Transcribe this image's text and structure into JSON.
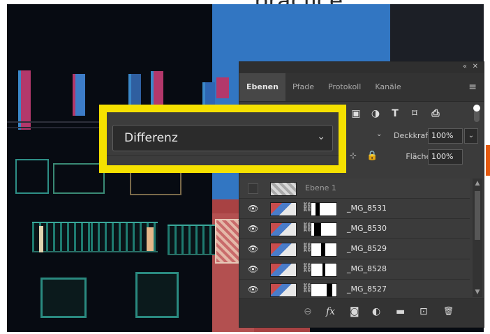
{
  "header": {
    "word": "practice"
  },
  "panel": {
    "tabs": [
      {
        "label": "Ebenen",
        "active": true
      },
      {
        "label": "Pfade",
        "active": false
      },
      {
        "label": "Protokoll",
        "active": false
      },
      {
        "label": "Kanäle",
        "active": false
      }
    ],
    "titlebar": {
      "collapse": "«",
      "close": "✕"
    },
    "menu_icon": "≡",
    "filter_icons": [
      "image-filter-icon",
      "adjustment-filter-icon",
      "type-filter-icon",
      "shape-filter-icon",
      "smart-object-filter-icon"
    ],
    "filter_glyphs": {
      "image": "▣",
      "adjustment": "◑",
      "type": "T",
      "shape": "⌑",
      "smart": "⎙"
    },
    "opacity": {
      "label": "Deckkraft:",
      "value": "100%"
    },
    "fill": {
      "label": "Fläche:",
      "value": "100%"
    },
    "blend_mode": "Differenz",
    "layers": [
      {
        "name": "Ebene 1",
        "visible": false
      },
      {
        "name": "_MG_8531",
        "visible": true
      },
      {
        "name": "_MG_8530",
        "visible": true
      },
      {
        "name": "_MG_8529",
        "visible": true
      },
      {
        "name": "_MG_8528",
        "visible": true
      },
      {
        "name": "_MG_8527",
        "visible": true
      }
    ],
    "bottom_icons": [
      "link-icon",
      "fx-icon",
      "mask-icon",
      "adjustment-icon",
      "folder-icon",
      "new-layer-icon",
      "trash-icon"
    ],
    "bottom_glyphs": {
      "link": "⊖",
      "fx": "fx",
      "mask": "◙",
      "adjustment": "◐",
      "folder": "▬",
      "new": "⊡",
      "trash": "🗑"
    }
  },
  "colors": {
    "highlight": "#f5e100",
    "panel_bg": "#3b3b3b",
    "accent_orange": "#e55a10"
  }
}
